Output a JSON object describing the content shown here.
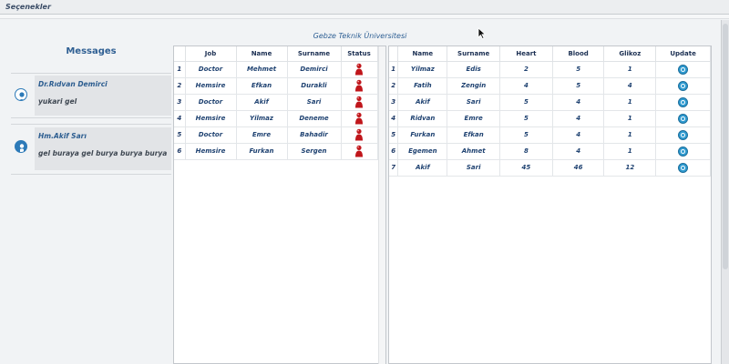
{
  "menubar": {
    "title": "Seçenekler"
  },
  "university": {
    "title": "Gebze Teknik Üniversitesi"
  },
  "messages": {
    "title": "Messages",
    "items": [
      {
        "sender": "Dr.Rıdvan Demirci",
        "text": "yukari gel",
        "icon": "doctor-avatar-icon"
      },
      {
        "sender": "Hm.Akif Sarı",
        "text": "gel buraya gel burya burya burya",
        "icon": "nurse-avatar-icon"
      }
    ]
  },
  "staff_table": {
    "columns": [
      "Job",
      "Name",
      "Surname",
      "Status"
    ],
    "status_icon": "person-status-icon",
    "status_color": "#c0161b",
    "rows": [
      {
        "index": "1",
        "job": "Doctor",
        "name": "Mehmet",
        "surname": "Demirci"
      },
      {
        "index": "2",
        "job": "Hemsire",
        "name": "Efkan",
        "surname": "Durakli"
      },
      {
        "index": "3",
        "job": "Doctor",
        "name": "Akif",
        "surname": "Sari"
      },
      {
        "index": "4",
        "job": "Hemsire",
        "name": "Yilmaz",
        "surname": "Deneme"
      },
      {
        "index": "5",
        "job": "Doctor",
        "name": "Emre",
        "surname": "Bahadir"
      },
      {
        "index": "6",
        "job": "Hemsire",
        "name": "Furkan",
        "surname": "Sergen"
      }
    ]
  },
  "patient_table": {
    "columns": [
      "Name",
      "Surname",
      "Heart",
      "Blood",
      "Glikoz",
      "Update"
    ],
    "update_icon": "refresh-icon",
    "update_color": "#2e9ad0",
    "rows": [
      {
        "index": "1",
        "name": "Yilmaz",
        "surname": "Edis",
        "heart": "2",
        "blood": "5",
        "glikoz": "1"
      },
      {
        "index": "2",
        "name": "Fatih",
        "surname": "Zengin",
        "heart": "4",
        "blood": "5",
        "glikoz": "4"
      },
      {
        "index": "3",
        "name": "Akif",
        "surname": "Sari",
        "heart": "5",
        "blood": "4",
        "glikoz": "1"
      },
      {
        "index": "4",
        "name": "Ridvan",
        "surname": "Emre",
        "heart": "5",
        "blood": "4",
        "glikoz": "1"
      },
      {
        "index": "5",
        "name": "Furkan",
        "surname": "Efkan",
        "heart": "5",
        "blood": "4",
        "glikoz": "1"
      },
      {
        "index": "6",
        "name": "Egemen",
        "surname": "Ahmet",
        "heart": "8",
        "blood": "4",
        "glikoz": "1"
      },
      {
        "index": "7",
        "name": "Akif",
        "surname": "Sari",
        "heart": "45",
        "blood": "46",
        "glikoz": "12"
      }
    ]
  }
}
